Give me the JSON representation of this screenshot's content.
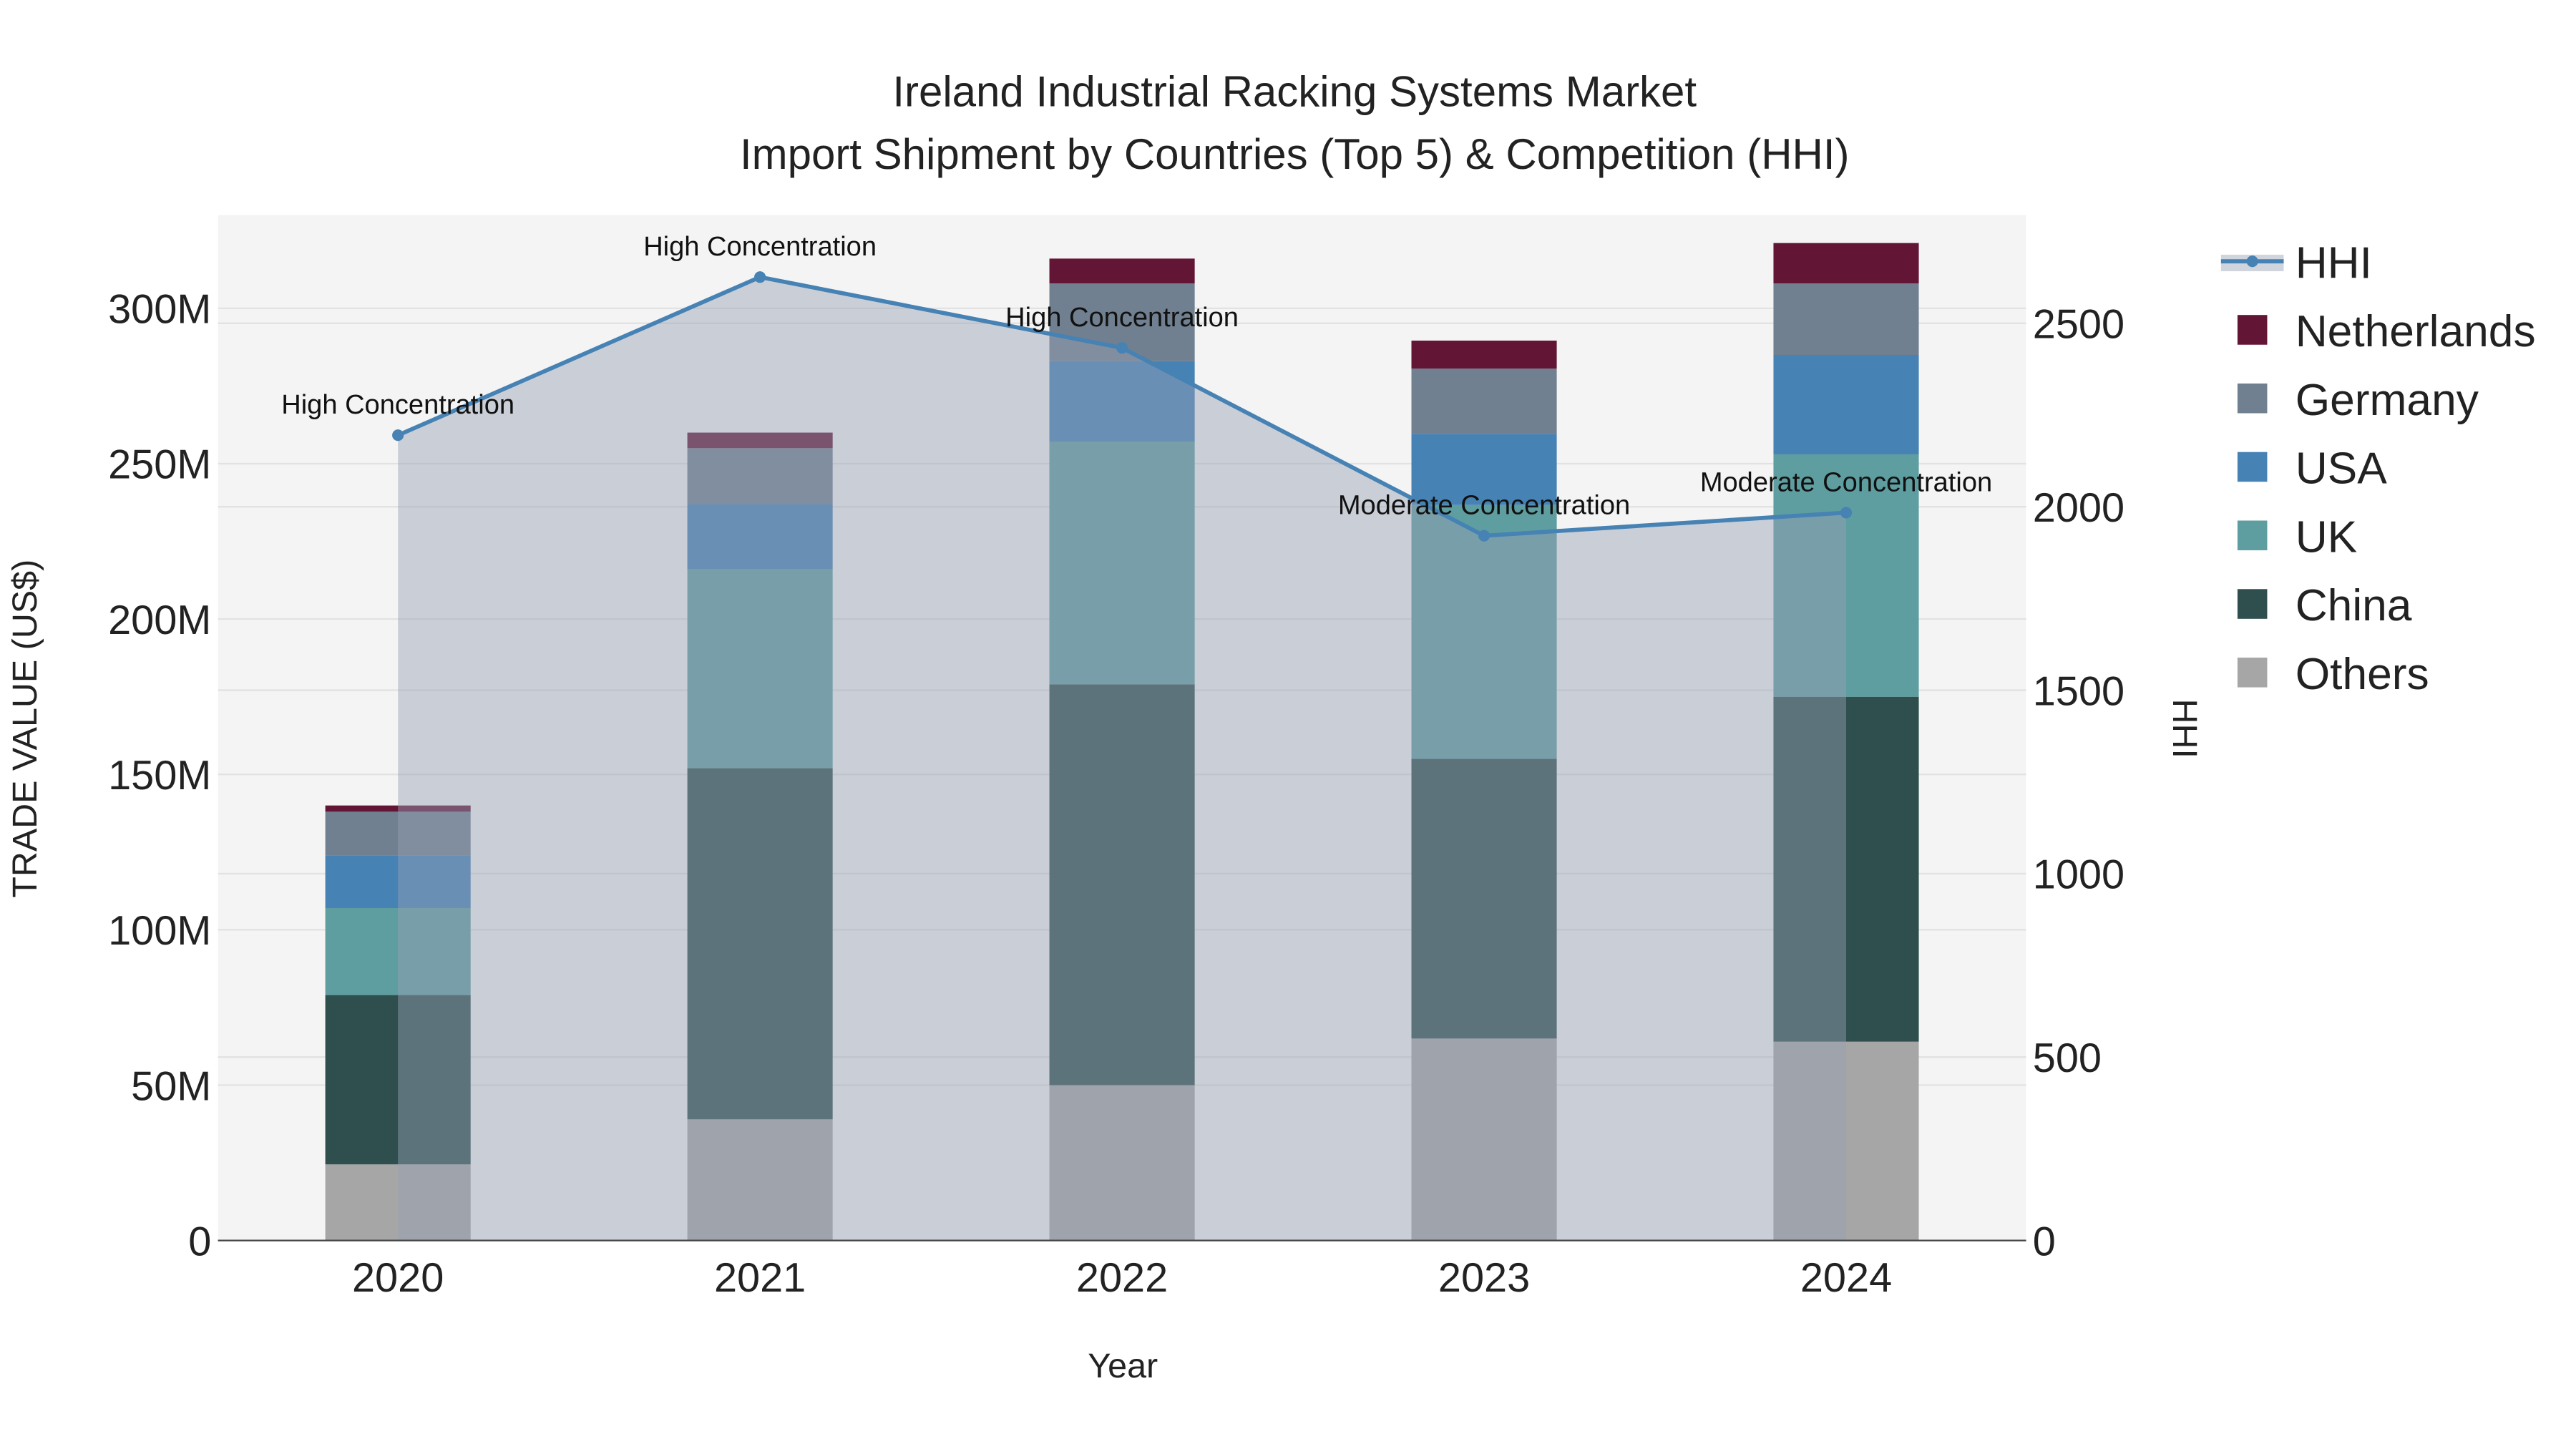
{
  "chart_data": {
    "type": "bar",
    "title_line1": "Ireland Industrial Racking Systems Market",
    "title_line2": "Import Shipment by Countries (Top 5) & Competition (HHI)",
    "xlabel": "Year",
    "ylabel": "TRADE VALUE (US$)",
    "y2label": "HHI",
    "categories": [
      "2020",
      "2021",
      "2022",
      "2023",
      "2024"
    ],
    "ylim": [
      0,
      330
    ],
    "y_unit": "M",
    "yticks": [
      0,
      50,
      100,
      150,
      200,
      250,
      300
    ],
    "ytick_labels": [
      "0",
      "50M",
      "100M",
      "150M",
      "200M",
      "250M",
      "300M"
    ],
    "y2lim": [
      0,
      2795
    ],
    "y2ticks": [
      0,
      500,
      1000,
      1500,
      2000,
      2500
    ],
    "y2tick_labels": [
      "0",
      "500",
      "1000",
      "1500",
      "2000",
      "2500"
    ],
    "series": [
      {
        "name": "Others",
        "color": "#a6a6a6",
        "values": [
          24.5,
          39,
          50,
          65,
          64
        ]
      },
      {
        "name": "China",
        "color": "#2f4f4f",
        "values": [
          54.5,
          113,
          129,
          90,
          111
        ]
      },
      {
        "name": "UK",
        "color": "#5f9ea0",
        "values": [
          28,
          64,
          78,
          81.7,
          78
        ]
      },
      {
        "name": "USA",
        "color": "#4682b4",
        "values": [
          17,
          21,
          26,
          22.9,
          32
        ]
      },
      {
        "name": "Germany",
        "color": "#708090",
        "values": [
          14,
          18,
          25,
          21,
          23
        ]
      },
      {
        "name": "Netherlands",
        "color": "#631536",
        "values": [
          2,
          5,
          8,
          9,
          13
        ]
      }
    ],
    "hhi": {
      "name": "HHI",
      "color": "#4682b4",
      "values": [
        2195,
        2626,
        2433,
        1921,
        1984
      ],
      "labels": [
        "High Concentration",
        "High Concentration",
        "High Concentration",
        "Moderate Concentration",
        "Moderate Concentration"
      ]
    },
    "legend_order": [
      "HHI",
      "Netherlands",
      "Germany",
      "USA",
      "UK",
      "China",
      "Others"
    ],
    "legend_position": "right",
    "grid": true
  }
}
